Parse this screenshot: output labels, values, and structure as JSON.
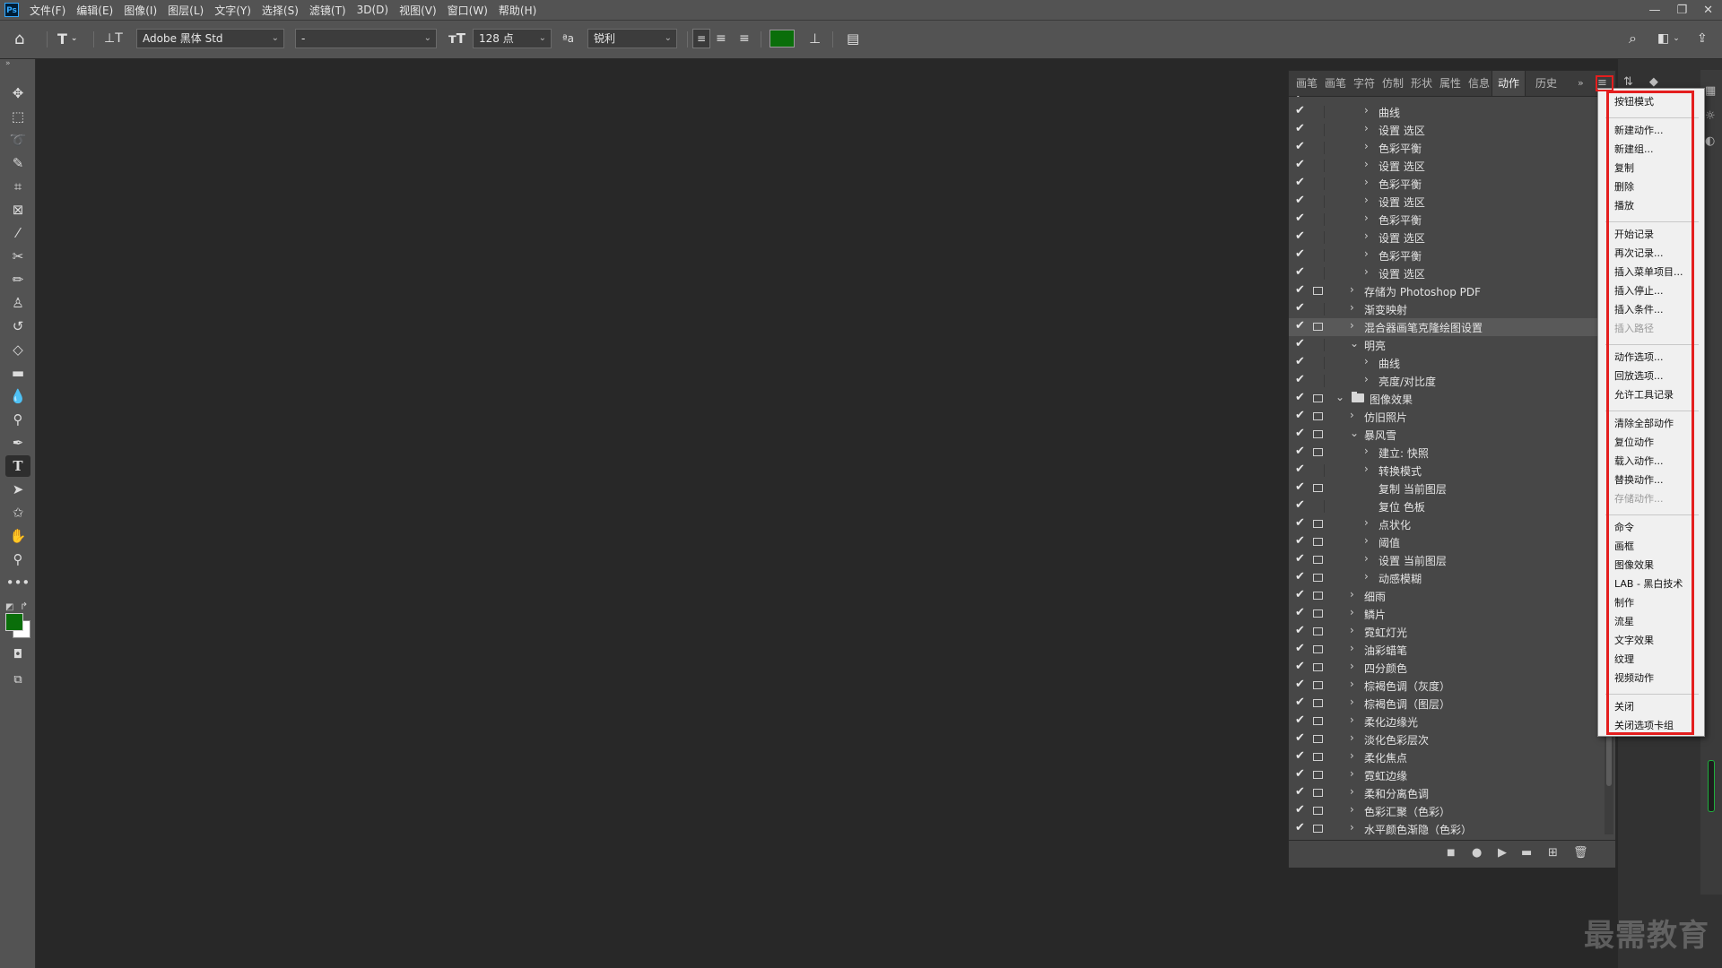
{
  "menubar": {
    "logo": "Ps",
    "items": [
      "文件(F)",
      "编辑(E)",
      "图像(I)",
      "图层(L)",
      "文字(Y)",
      "选择(S)",
      "滤镜(T)",
      "3D(D)",
      "视图(V)",
      "窗口(W)",
      "帮助(H)"
    ]
  },
  "options": {
    "font_family": "Adobe 黑体 Std",
    "font_style": "-",
    "font_size": "128 点",
    "antialias": "锐利",
    "text_color": "#0a6e0a"
  },
  "panel": {
    "tabs": [
      "画笔",
      "画笔",
      "字符",
      "仿制",
      "形状",
      "属性",
      "信息",
      "动作",
      "历史"
    ],
    "active_tab": "动作",
    "rows": [
      {
        "label": "曲线",
        "check": true,
        "dialog": false,
        "indent": 2,
        "expander": ">"
      },
      {
        "label": "设置 选区",
        "check": true,
        "dialog": false,
        "indent": 2,
        "expander": ">"
      },
      {
        "label": "色彩平衡",
        "check": true,
        "dialog": false,
        "indent": 2,
        "expander": ">"
      },
      {
        "label": "设置 选区",
        "check": true,
        "dialog": false,
        "indent": 2,
        "expander": ">"
      },
      {
        "label": "色彩平衡",
        "check": true,
        "dialog": false,
        "indent": 2,
        "expander": ">"
      },
      {
        "label": "设置 选区",
        "check": true,
        "dialog": false,
        "indent": 2,
        "expander": ">"
      },
      {
        "label": "色彩平衡",
        "check": true,
        "dialog": false,
        "indent": 2,
        "expander": ">"
      },
      {
        "label": "设置 选区",
        "check": true,
        "dialog": false,
        "indent": 2,
        "expander": ">"
      },
      {
        "label": "色彩平衡",
        "check": true,
        "dialog": false,
        "indent": 2,
        "expander": ">"
      },
      {
        "label": "设置 选区",
        "check": true,
        "dialog": false,
        "indent": 2,
        "expander": ">"
      },
      {
        "label": "存储为 Photoshop PDF",
        "check": true,
        "dialog": true,
        "indent": 1,
        "expander": ">"
      },
      {
        "label": "渐变映射",
        "check": true,
        "dialog": false,
        "indent": 1,
        "expander": ">"
      },
      {
        "label": "混合器画笔克隆绘图设置",
        "check": true,
        "dialog": true,
        "indent": 1,
        "expander": ">",
        "highlight": true
      },
      {
        "label": "明亮",
        "check": true,
        "dialog": false,
        "indent": 1,
        "expander": "v"
      },
      {
        "label": "曲线",
        "check": true,
        "dialog": false,
        "indent": 2,
        "expander": ">"
      },
      {
        "label": "亮度/对比度",
        "check": true,
        "dialog": false,
        "indent": 2,
        "expander": ">"
      },
      {
        "label": "图像效果",
        "check": true,
        "dialog": true,
        "indent": 0,
        "expander": "v",
        "folder": true
      },
      {
        "label": "仿旧照片",
        "check": true,
        "dialog": true,
        "indent": 1,
        "expander": ">"
      },
      {
        "label": "暴风雪",
        "check": true,
        "dialog": true,
        "indent": 1,
        "expander": "v"
      },
      {
        "label": "建立: 快照",
        "check": true,
        "dialog": true,
        "indent": 2,
        "expander": ">"
      },
      {
        "label": "转换模式",
        "check": true,
        "dialog": false,
        "indent": 2,
        "expander": ">"
      },
      {
        "label": "复制 当前图层",
        "check": true,
        "dialog": true,
        "indent": 2,
        "expander": ""
      },
      {
        "label": "复位 色板",
        "check": true,
        "dialog": false,
        "indent": 2,
        "expander": ""
      },
      {
        "label": "点状化",
        "check": true,
        "dialog": true,
        "indent": 2,
        "expander": ">"
      },
      {
        "label": "阈值",
        "check": true,
        "dialog": true,
        "indent": 2,
        "expander": ">"
      },
      {
        "label": "设置 当前图层",
        "check": true,
        "dialog": true,
        "indent": 2,
        "expander": ">"
      },
      {
        "label": "动感模糊",
        "check": true,
        "dialog": true,
        "indent": 2,
        "expander": ">"
      },
      {
        "label": "细雨",
        "check": true,
        "dialog": true,
        "indent": 1,
        "expander": ">"
      },
      {
        "label": "鳞片",
        "check": true,
        "dialog": true,
        "indent": 1,
        "expander": ">"
      },
      {
        "label": "霓虹灯光",
        "check": true,
        "dialog": true,
        "indent": 1,
        "expander": ">"
      },
      {
        "label": "油彩蜡笔",
        "check": true,
        "dialog": true,
        "indent": 1,
        "expander": ">"
      },
      {
        "label": "四分颜色",
        "check": true,
        "dialog": true,
        "indent": 1,
        "expander": ">"
      },
      {
        "label": "棕褐色调（灰度）",
        "check": true,
        "dialog": true,
        "indent": 1,
        "expander": ">"
      },
      {
        "label": "棕褐色调（图层）",
        "check": true,
        "dialog": true,
        "indent": 1,
        "expander": ">"
      },
      {
        "label": "柔化边缘光",
        "check": true,
        "dialog": true,
        "indent": 1,
        "expander": ">"
      },
      {
        "label": "淡化色彩层次",
        "check": true,
        "dialog": true,
        "indent": 1,
        "expander": ">"
      },
      {
        "label": "柔化焦点",
        "check": true,
        "dialog": true,
        "indent": 1,
        "expander": ">"
      },
      {
        "label": "霓虹边缘",
        "check": true,
        "dialog": true,
        "indent": 1,
        "expander": ">"
      },
      {
        "label": "柔和分离色调",
        "check": true,
        "dialog": true,
        "indent": 1,
        "expander": ">"
      },
      {
        "label": "色彩汇聚（色彩）",
        "check": true,
        "dialog": true,
        "indent": 1,
        "expander": ">"
      },
      {
        "label": "水平颜色渐隐（色彩）",
        "check": true,
        "dialog": true,
        "indent": 1,
        "expander": ">"
      }
    ]
  },
  "flyout": {
    "items": [
      {
        "label": "按钮模式"
      },
      {
        "sep": true
      },
      {
        "label": "新建动作..."
      },
      {
        "label": "新建组..."
      },
      {
        "label": "复制"
      },
      {
        "label": "删除"
      },
      {
        "label": "播放"
      },
      {
        "sep": true
      },
      {
        "label": "开始记录"
      },
      {
        "label": "再次记录..."
      },
      {
        "label": "插入菜单项目..."
      },
      {
        "label": "插入停止..."
      },
      {
        "label": "插入条件..."
      },
      {
        "label": "插入路径",
        "disabled": true
      },
      {
        "sep": true
      },
      {
        "label": "动作选项..."
      },
      {
        "label": "回放选项..."
      },
      {
        "label": "允许工具记录"
      },
      {
        "sep": true
      },
      {
        "label": "清除全部动作"
      },
      {
        "label": "复位动作"
      },
      {
        "label": "载入动作..."
      },
      {
        "label": "替换动作..."
      },
      {
        "label": "存储动作...",
        "disabled": true
      },
      {
        "sep": true
      },
      {
        "label": "命令"
      },
      {
        "label": "画框"
      },
      {
        "label": "图像效果"
      },
      {
        "label": "LAB - 黑白技术"
      },
      {
        "label": "制作"
      },
      {
        "label": "流星"
      },
      {
        "label": "文字效果"
      },
      {
        "label": "纹理"
      },
      {
        "label": "视频动作"
      },
      {
        "sep": true
      },
      {
        "label": "关闭"
      },
      {
        "label": "关闭选项卡组"
      }
    ]
  },
  "watermark": "最需教育"
}
